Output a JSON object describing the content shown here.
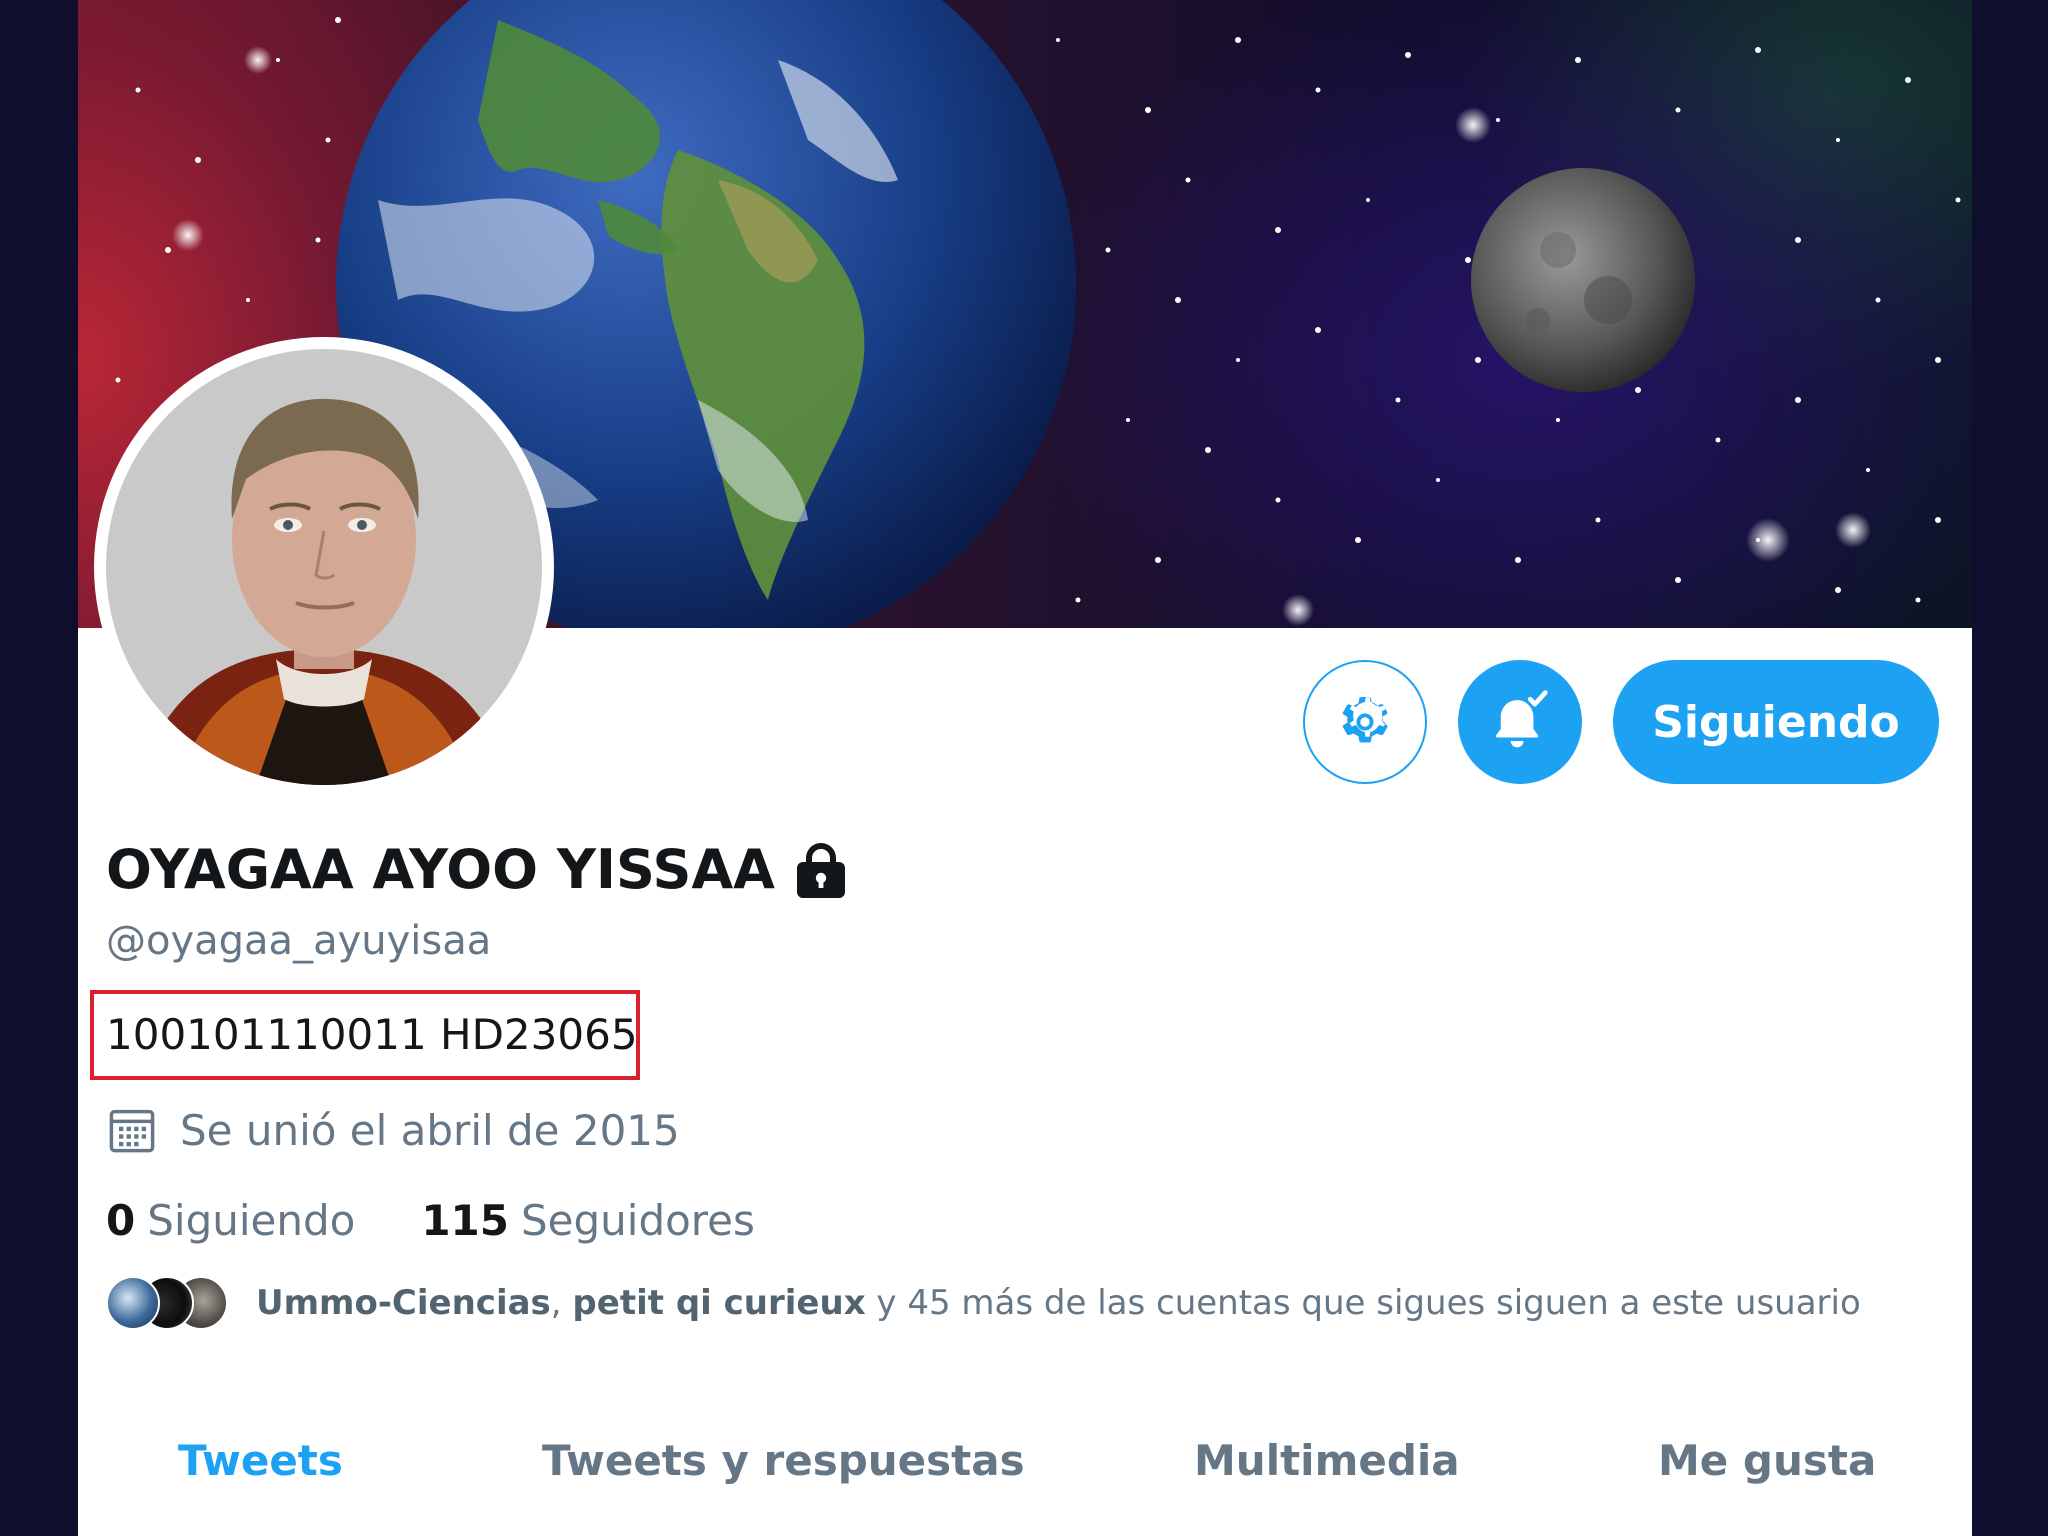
{
  "profile": {
    "display_name": "OYAGAA AYOO YISSAA",
    "handle": "@oyagaa_ayuyisaa",
    "bio": "100101110011 HD23065",
    "joined": "Se unió el abril de 2015",
    "following_count": "0",
    "following_label": "Siguiendo",
    "followers_count": "115",
    "followers_label": "Seguidores"
  },
  "actions": {
    "settings_icon": "gear-icon",
    "notifications_icon": "bell-check-icon",
    "follow_label": "Siguiendo"
  },
  "followers_you_know": {
    "name_1": "Ummo-Ciencias",
    "separator": ", ",
    "name_2": "petit qi curieux",
    "rest": " y 45 más de las cuentas que sigues siguen a este usuario"
  },
  "tabs": [
    {
      "label": "Tweets",
      "active": true
    },
    {
      "label": "Tweets y respuestas",
      "active": false
    },
    {
      "label": "Multimedia",
      "active": false
    },
    {
      "label": "Me gusta",
      "active": false
    }
  ],
  "colors": {
    "accent": "#1da1f2",
    "highlight_box": "#d9202e",
    "text_primary": "#14171a",
    "text_secondary": "#657786"
  }
}
